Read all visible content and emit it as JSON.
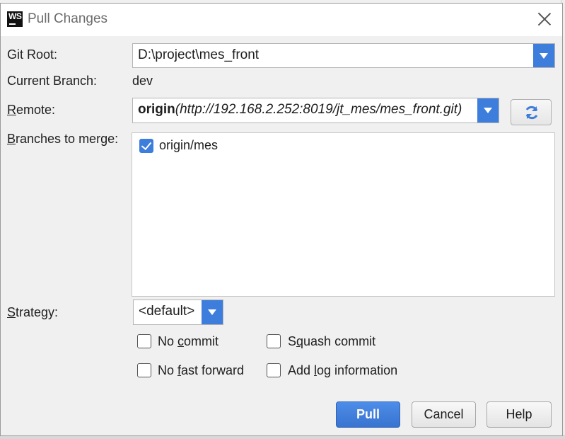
{
  "dialog": {
    "title": "Pull Changes",
    "app_icon_text": "WS"
  },
  "fields": {
    "git_root_label": "Git Root:",
    "git_root_value": "D:\\project\\mes_front",
    "current_branch_label": "Current Branch:",
    "current_branch_value": "dev",
    "remote_label_u": "R",
    "remote_label_rest": "emote:",
    "remote_name": "origin",
    "remote_url": "(http://192.168.2.252:8019/jt_mes/mes_front.git)",
    "branches_label_u": "B",
    "branches_label_rest": "ranches to merge:",
    "strategy_label_u": "S",
    "strategy_label_rest": "trategy:",
    "strategy_value": "<default>"
  },
  "branches": [
    {
      "name": "origin/mes",
      "checked": true
    }
  ],
  "options": {
    "no_commit_a": "No ",
    "no_commit_u": "c",
    "no_commit_b": "ommit",
    "squash_commit_a": "S",
    "squash_commit_u": "q",
    "squash_commit_b": "uash commit",
    "no_fast_forward_a": "No ",
    "no_fast_forward_u": "f",
    "no_fast_forward_b": "ast forward",
    "add_log_a": "Add ",
    "add_log_u": "l",
    "add_log_b": "og information"
  },
  "buttons": {
    "pull": "Pull",
    "cancel": "Cancel",
    "help": "Help"
  },
  "colors": {
    "accent": "#3d7ddb",
    "title_text": "#6b6b6b"
  },
  "icons": {
    "close": "close-icon",
    "refresh": "refresh-icon",
    "dropdown": "chevron-down-icon"
  }
}
